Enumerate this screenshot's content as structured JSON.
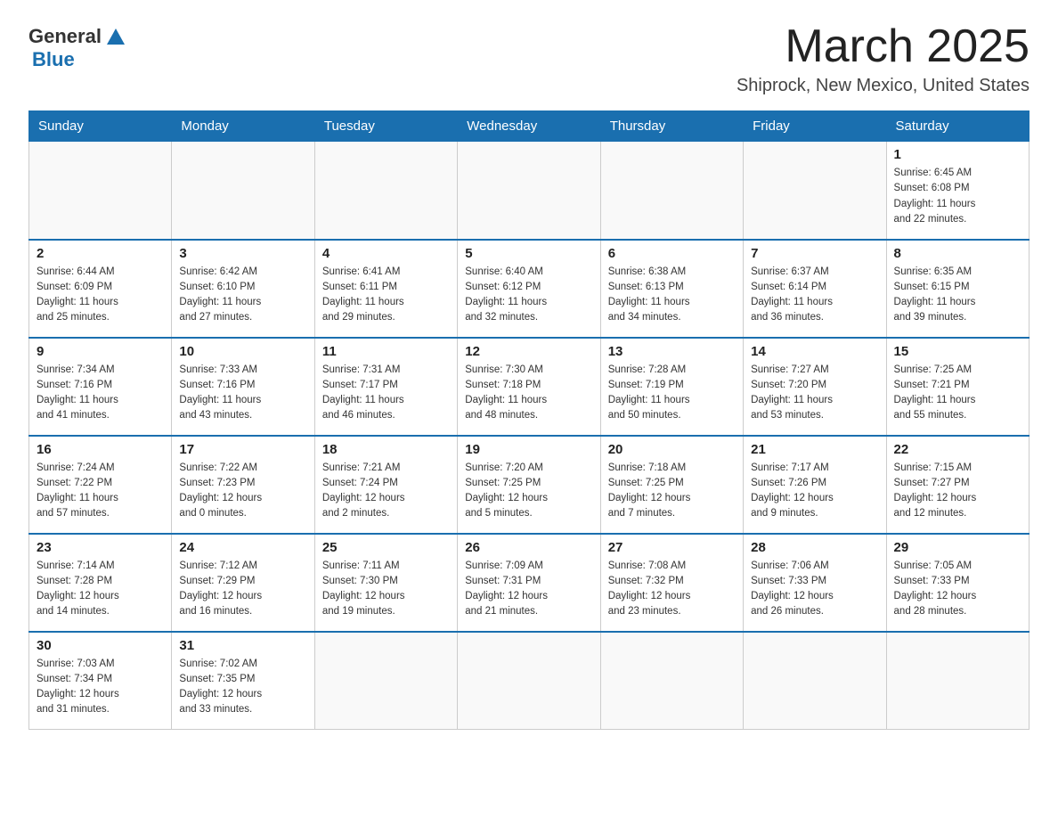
{
  "header": {
    "logo_general": "General",
    "logo_blue": "Blue",
    "title": "March 2025",
    "subtitle": "Shiprock, New Mexico, United States"
  },
  "weekdays": [
    "Sunday",
    "Monday",
    "Tuesday",
    "Wednesday",
    "Thursday",
    "Friday",
    "Saturday"
  ],
  "weeks": [
    [
      {
        "day": "",
        "info": ""
      },
      {
        "day": "",
        "info": ""
      },
      {
        "day": "",
        "info": ""
      },
      {
        "day": "",
        "info": ""
      },
      {
        "day": "",
        "info": ""
      },
      {
        "day": "",
        "info": ""
      },
      {
        "day": "1",
        "info": "Sunrise: 6:45 AM\nSunset: 6:08 PM\nDaylight: 11 hours\nand 22 minutes."
      }
    ],
    [
      {
        "day": "2",
        "info": "Sunrise: 6:44 AM\nSunset: 6:09 PM\nDaylight: 11 hours\nand 25 minutes."
      },
      {
        "day": "3",
        "info": "Sunrise: 6:42 AM\nSunset: 6:10 PM\nDaylight: 11 hours\nand 27 minutes."
      },
      {
        "day": "4",
        "info": "Sunrise: 6:41 AM\nSunset: 6:11 PM\nDaylight: 11 hours\nand 29 minutes."
      },
      {
        "day": "5",
        "info": "Sunrise: 6:40 AM\nSunset: 6:12 PM\nDaylight: 11 hours\nand 32 minutes."
      },
      {
        "day": "6",
        "info": "Sunrise: 6:38 AM\nSunset: 6:13 PM\nDaylight: 11 hours\nand 34 minutes."
      },
      {
        "day": "7",
        "info": "Sunrise: 6:37 AM\nSunset: 6:14 PM\nDaylight: 11 hours\nand 36 minutes."
      },
      {
        "day": "8",
        "info": "Sunrise: 6:35 AM\nSunset: 6:15 PM\nDaylight: 11 hours\nand 39 minutes."
      }
    ],
    [
      {
        "day": "9",
        "info": "Sunrise: 7:34 AM\nSunset: 7:16 PM\nDaylight: 11 hours\nand 41 minutes."
      },
      {
        "day": "10",
        "info": "Sunrise: 7:33 AM\nSunset: 7:16 PM\nDaylight: 11 hours\nand 43 minutes."
      },
      {
        "day": "11",
        "info": "Sunrise: 7:31 AM\nSunset: 7:17 PM\nDaylight: 11 hours\nand 46 minutes."
      },
      {
        "day": "12",
        "info": "Sunrise: 7:30 AM\nSunset: 7:18 PM\nDaylight: 11 hours\nand 48 minutes."
      },
      {
        "day": "13",
        "info": "Sunrise: 7:28 AM\nSunset: 7:19 PM\nDaylight: 11 hours\nand 50 minutes."
      },
      {
        "day": "14",
        "info": "Sunrise: 7:27 AM\nSunset: 7:20 PM\nDaylight: 11 hours\nand 53 minutes."
      },
      {
        "day": "15",
        "info": "Sunrise: 7:25 AM\nSunset: 7:21 PM\nDaylight: 11 hours\nand 55 minutes."
      }
    ],
    [
      {
        "day": "16",
        "info": "Sunrise: 7:24 AM\nSunset: 7:22 PM\nDaylight: 11 hours\nand 57 minutes."
      },
      {
        "day": "17",
        "info": "Sunrise: 7:22 AM\nSunset: 7:23 PM\nDaylight: 12 hours\nand 0 minutes."
      },
      {
        "day": "18",
        "info": "Sunrise: 7:21 AM\nSunset: 7:24 PM\nDaylight: 12 hours\nand 2 minutes."
      },
      {
        "day": "19",
        "info": "Sunrise: 7:20 AM\nSunset: 7:25 PM\nDaylight: 12 hours\nand 5 minutes."
      },
      {
        "day": "20",
        "info": "Sunrise: 7:18 AM\nSunset: 7:25 PM\nDaylight: 12 hours\nand 7 minutes."
      },
      {
        "day": "21",
        "info": "Sunrise: 7:17 AM\nSunset: 7:26 PM\nDaylight: 12 hours\nand 9 minutes."
      },
      {
        "day": "22",
        "info": "Sunrise: 7:15 AM\nSunset: 7:27 PM\nDaylight: 12 hours\nand 12 minutes."
      }
    ],
    [
      {
        "day": "23",
        "info": "Sunrise: 7:14 AM\nSunset: 7:28 PM\nDaylight: 12 hours\nand 14 minutes."
      },
      {
        "day": "24",
        "info": "Sunrise: 7:12 AM\nSunset: 7:29 PM\nDaylight: 12 hours\nand 16 minutes."
      },
      {
        "day": "25",
        "info": "Sunrise: 7:11 AM\nSunset: 7:30 PM\nDaylight: 12 hours\nand 19 minutes."
      },
      {
        "day": "26",
        "info": "Sunrise: 7:09 AM\nSunset: 7:31 PM\nDaylight: 12 hours\nand 21 minutes."
      },
      {
        "day": "27",
        "info": "Sunrise: 7:08 AM\nSunset: 7:32 PM\nDaylight: 12 hours\nand 23 minutes."
      },
      {
        "day": "28",
        "info": "Sunrise: 7:06 AM\nSunset: 7:33 PM\nDaylight: 12 hours\nand 26 minutes."
      },
      {
        "day": "29",
        "info": "Sunrise: 7:05 AM\nSunset: 7:33 PM\nDaylight: 12 hours\nand 28 minutes."
      }
    ],
    [
      {
        "day": "30",
        "info": "Sunrise: 7:03 AM\nSunset: 7:34 PM\nDaylight: 12 hours\nand 31 minutes."
      },
      {
        "day": "31",
        "info": "Sunrise: 7:02 AM\nSunset: 7:35 PM\nDaylight: 12 hours\nand 33 minutes."
      },
      {
        "day": "",
        "info": ""
      },
      {
        "day": "",
        "info": ""
      },
      {
        "day": "",
        "info": ""
      },
      {
        "day": "",
        "info": ""
      },
      {
        "day": "",
        "info": ""
      }
    ]
  ]
}
